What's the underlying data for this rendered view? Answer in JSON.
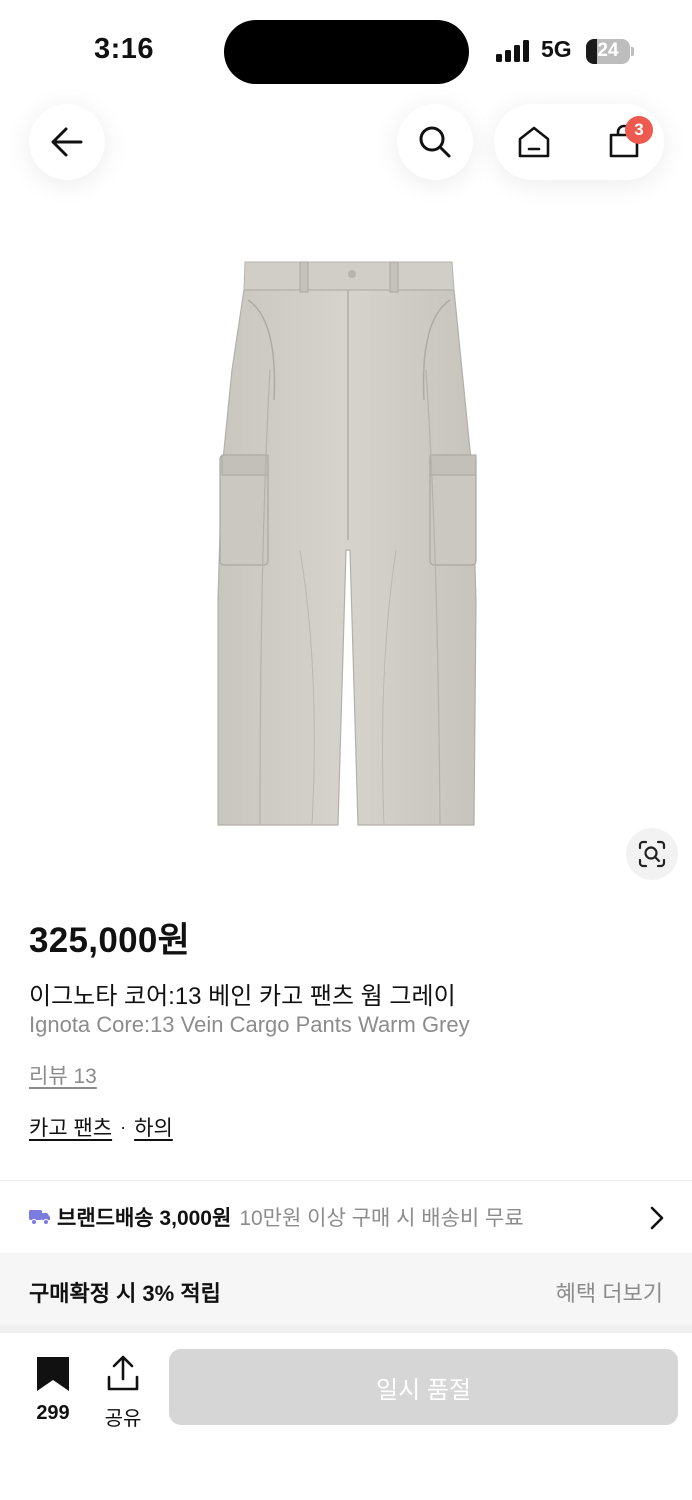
{
  "status_bar": {
    "time": "3:16",
    "network": "5G",
    "battery": "24",
    "battery_level": 0.24
  },
  "nav": {
    "cart_count": "3"
  },
  "product": {
    "price": "325,000원",
    "title_kr": "이그노타 코어:13 베인 카고 팬츠 웜 그레이",
    "title_en": "Ignota Core:13 Vein Cargo Pants Warm Grey",
    "review": "리뷰 13",
    "category_primary": "카고 팬츠",
    "category_separator": "·",
    "category_secondary": "하의"
  },
  "shipping": {
    "label": "브랜드배송 3,000원",
    "note": "10만원 이상 구매 시 배송비 무료"
  },
  "points": {
    "text": "구매확정 시 3% 적립",
    "more": "혜택 더보기"
  },
  "bottom_bar": {
    "bookmark_count": "299",
    "share_label": "공유",
    "soldout_label": "일시 품절"
  },
  "colors": {
    "accent_badge": "#ee5a4f",
    "truck_icon": "#7b7be0",
    "disabled_button": "#d6d6d6"
  }
}
